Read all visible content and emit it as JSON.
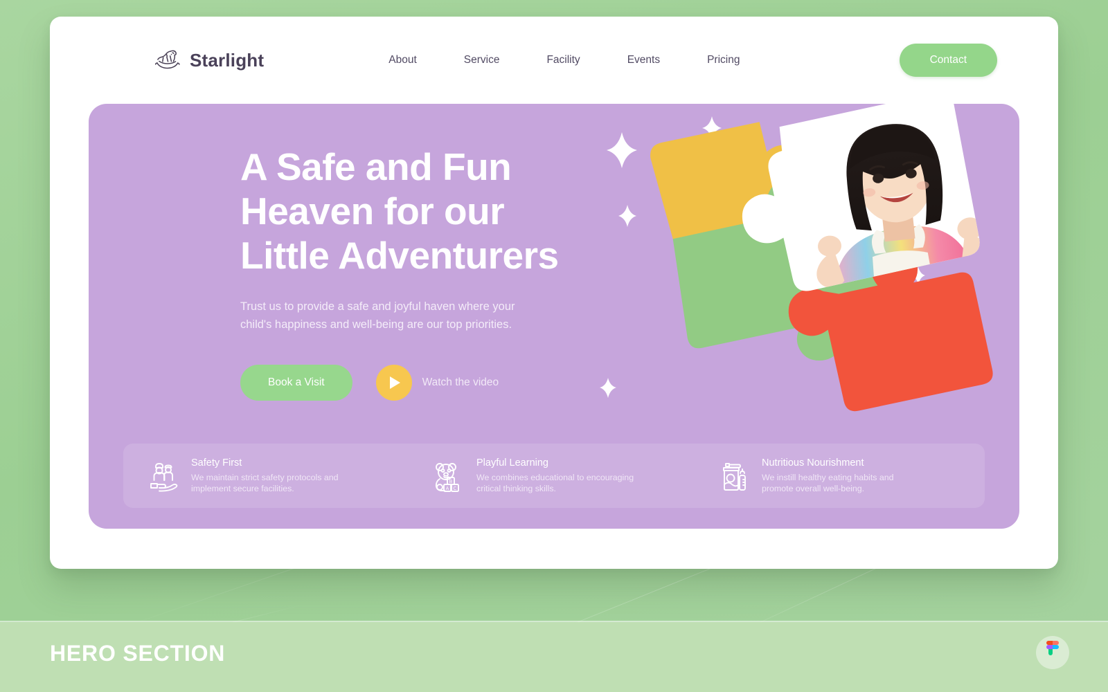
{
  "navbar": {
    "brand": {
      "name": "Starlight",
      "icon": "rocking-horse-icon"
    },
    "links": [
      {
        "label": "About"
      },
      {
        "label": "Service"
      },
      {
        "label": "Facility"
      },
      {
        "label": "Events"
      },
      {
        "label": "Pricing"
      }
    ],
    "contact_label": "Contact"
  },
  "hero": {
    "title": "A Safe and Fun\nHeaven for our\nLittle Adventurers",
    "subtitle": "Trust us to provide a safe and joyful haven where your child's happiness and well-being are our top priorities.",
    "primary_cta": "Book a Visit",
    "video_label": "Watch the video",
    "play_icon": "play-triangle-icon",
    "background_color": "#c6a5dc",
    "illustration": {
      "name": "jigsaw-puzzle-photo-illustration",
      "pieces": [
        {
          "name": "yellow-puzzle-piece",
          "color": "#f0c046"
        },
        {
          "name": "green-puzzle-piece",
          "color": "#92cb84"
        },
        {
          "name": "red-puzzle-piece",
          "color": "#f2543c"
        },
        {
          "name": "white-photo-puzzle-piece",
          "color": "#ffffff"
        }
      ],
      "photo_alt": "smiling young girl in colorful shirt and white overalls",
      "sparkle_count": 8
    }
  },
  "features": [
    {
      "icon": "family-in-hand-icon",
      "title": "Safety First",
      "desc": "We maintain strict safety protocols and implement secure facilities."
    },
    {
      "icon": "teddy-bear-blocks-icon",
      "title": "Playful Learning",
      "desc": "We combines educational to encouraging critical thinking skills."
    },
    {
      "icon": "baby-formula-bottle-icon",
      "title": "Nutritious Nourishment",
      "desc": "We instill healthy eating habits and promote overall well-being."
    }
  ],
  "bottom_band": {
    "label": "HERO SECTION",
    "badge_icon": "figma-logo-icon"
  },
  "colors": {
    "page_background": "#a3d49a",
    "band_background": "#bfdfb3",
    "hero_purple": "#c6a5dc",
    "accent_green": "#94d68a",
    "accent_yellow": "#f7c74f",
    "text_dark": "#4a4159"
  }
}
